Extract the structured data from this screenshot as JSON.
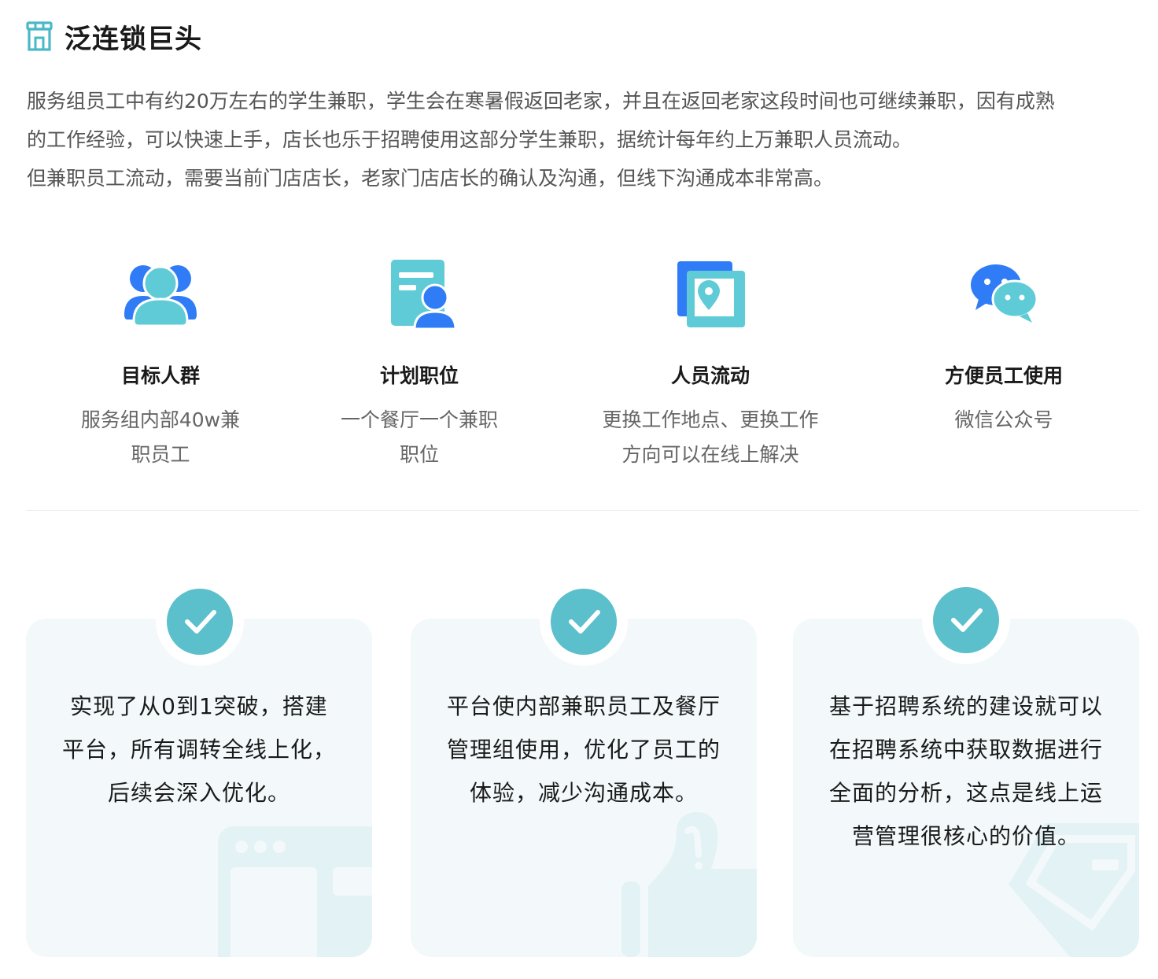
{
  "header": {
    "icon": "store-icon",
    "title": "泛连锁巨头"
  },
  "intro": {
    "line1": "服务组员工中有约20万左右的学生兼职，学生会在寒暑假返回老家，并且在返回老家这段时间也可继续兼职，因有成熟",
    "line2": "的工作经验，可以快速上手，店长也乐于招聘使用这部分学生兼职，据统计每年约上万兼职人员流动。",
    "line3": "但兼职员工流动，需要当前门店店长，老家门店店长的确认及沟通，但线下沟通成本非常高。"
  },
  "features": [
    {
      "icon": "users-group-icon",
      "name": "目标人群",
      "desc1": "服务组内部40w兼",
      "desc2": "职员工"
    },
    {
      "icon": "job-card-icon",
      "name": "计划职位",
      "desc1": "一个餐厅一个兼职",
      "desc2": "职位"
    },
    {
      "icon": "location-map-icon",
      "name": "人员流动",
      "desc1": "更换工作地点、更换工作",
      "desc2": "方向可以在线上解决"
    },
    {
      "icon": "wechat-chat-icon",
      "name": "方便员工使用",
      "desc1": "微信公众号",
      "desc2": ""
    }
  ],
  "cards": [
    {
      "icon": "check-icon",
      "line1": "实现了从0到1突破，搭建",
      "line2": "平台，所有调转全线上化，",
      "line3": "后续会深入优化。",
      "line4": ""
    },
    {
      "icon": "check-icon",
      "line1": "平台使内部兼职员工及餐厅",
      "line2": "管理组使用，优化了员工的",
      "line3": "体验，减少沟通成本。",
      "line4": ""
    },
    {
      "icon": "check-icon",
      "line1": "基于招聘系统的建设就可以",
      "line2": "在招聘系统中获取数据进行",
      "line3": "全面的分析，这点是线上运",
      "line4": "营管理很核心的价值。"
    }
  ],
  "colors": {
    "accent_teal": "#5bbfcc",
    "accent_blue": "#2f7cf6",
    "card_bg": "#f3f9fb",
    "text_dark": "#1a1a1a",
    "text_muted": "#666666"
  }
}
